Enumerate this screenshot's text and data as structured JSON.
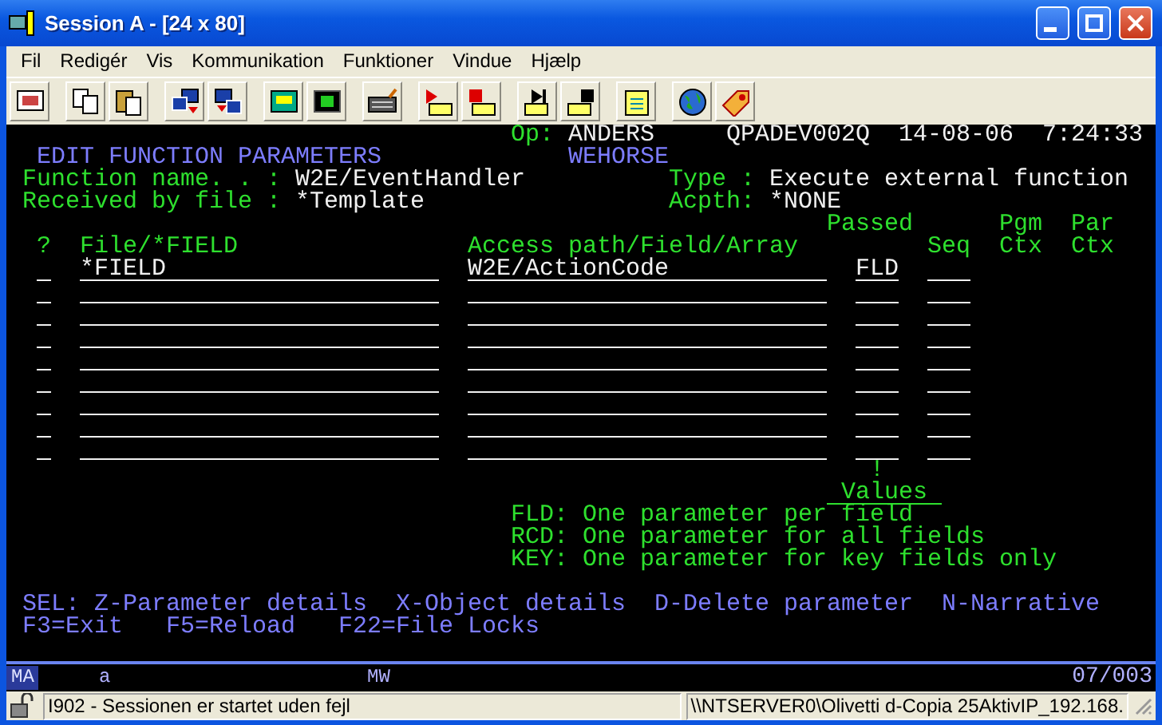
{
  "window": {
    "title": "Session A - [24 x 80]"
  },
  "menu": [
    "Fil",
    "Redigér",
    "Vis",
    "Kommunikation",
    "Funktioner",
    "Vindue",
    "Hjælp"
  ],
  "terminal": {
    "header": {
      "op_label": "Op:",
      "operator": "ANDERS",
      "device": "QPADEV002Q",
      "date": "14-08-06",
      "time": "7:24:33"
    },
    "title": "EDIT FUNCTION PARAMETERS",
    "environment": "WEHORSE",
    "fields": [
      {
        "label": "Function name. . :",
        "value": "W2E/EventHandler"
      },
      {
        "label": "Type :",
        "value": "Execute external function"
      },
      {
        "label": "Received by file :",
        "value": "*Template"
      },
      {
        "label": "Acpth:",
        "value": "*NONE"
      }
    ],
    "header_rows": [
      [
        "Passed",
        "Pgm",
        "Par"
      ],
      [
        "?",
        "File/*FIELD",
        "Access path/Field/Array",
        "Seq",
        "Ctx",
        "Ctx"
      ]
    ],
    "rows": [
      {
        "file_field": "*FIELD",
        "access_path": "W2E/ActionCode",
        "passed": "FLD"
      },
      {},
      {},
      {},
      {},
      {},
      {},
      {},
      {}
    ],
    "values_marker": "!",
    "values_title": "Values",
    "values": [
      {
        "code": "FLD:",
        "meaning": "One parameter per field"
      },
      {
        "code": "RCD:",
        "meaning": "One parameter for all fields"
      },
      {
        "code": "KEY:",
        "meaning": "One parameter for key fields only"
      }
    ],
    "options": [
      "SEL: Z-Parameter details",
      "X-Object details",
      "D-Delete parameter",
      "N-Narrative"
    ],
    "function_keys": [
      "F3=Exit",
      "F5=Reload",
      "F22=File Locks"
    ]
  },
  "oia": {
    "mode": "MA",
    "shift": "a",
    "indicator": "MW",
    "cursor": "07/003"
  },
  "status_bar": {
    "message": "I902 - Sessionen er startet uden fejl",
    "printer": "\\\\NTSERVER0\\Olivetti d-Copia 25AktivIP_192.168."
  }
}
